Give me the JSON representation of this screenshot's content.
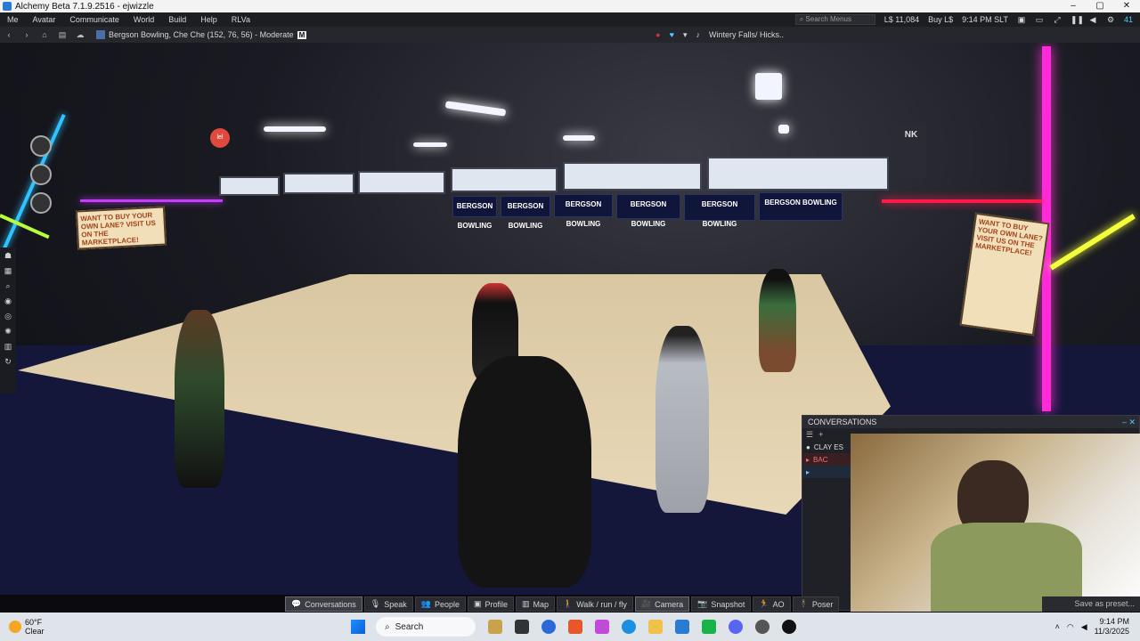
{
  "window": {
    "title": "Alchemy Beta 7.1.9.2516 - ejwizzle"
  },
  "menu": {
    "items": [
      "Me",
      "Avatar",
      "Communicate",
      "World",
      "Build",
      "Help",
      "RLVa"
    ],
    "search_placeholder": "Search Menus",
    "balance": "L$ 11,084",
    "buy_label": "Buy L$",
    "time": "9:14 PM SLT",
    "count": "41"
  },
  "nav": {
    "location": "Bergson Bowling, Che Che (152, 76, 56) - Moderate",
    "rating_badge": "M",
    "parcel_media": "Wintery Falls/ Hicks.."
  },
  "scene": {
    "poster_left": "WANT TO BUY YOUR OWN LANE? VISIT US ON THE MARKETPLACE!",
    "poster_right": "WANT TO BUY YOUR OWN LANE? VISIT US ON THE MARKETPLACE!",
    "lane_sign": "BERGSON BOWLING",
    "nk_label": "NK"
  },
  "conversations": {
    "title": "CONVERSATIONS",
    "rows": [
      "CLAY ES",
      "BAC",
      ""
    ]
  },
  "bottom_toolbar": {
    "buttons": [
      "Conversations",
      "Speak",
      "People",
      "Profile",
      "Map",
      "Walk / run / fly",
      "Camera",
      "Snapshot",
      "AO",
      "Poser"
    ],
    "save_preset": "Save as preset..."
  },
  "taskbar": {
    "temperature": "60°F",
    "condition": "Clear",
    "search": "Search",
    "time": "9:14 PM",
    "date": "11/3/2025"
  },
  "colors": {
    "accent_pink": "#ff2bd6",
    "accent_cyan": "#2fc3ff",
    "accent_yellow": "#f3ff3a"
  }
}
